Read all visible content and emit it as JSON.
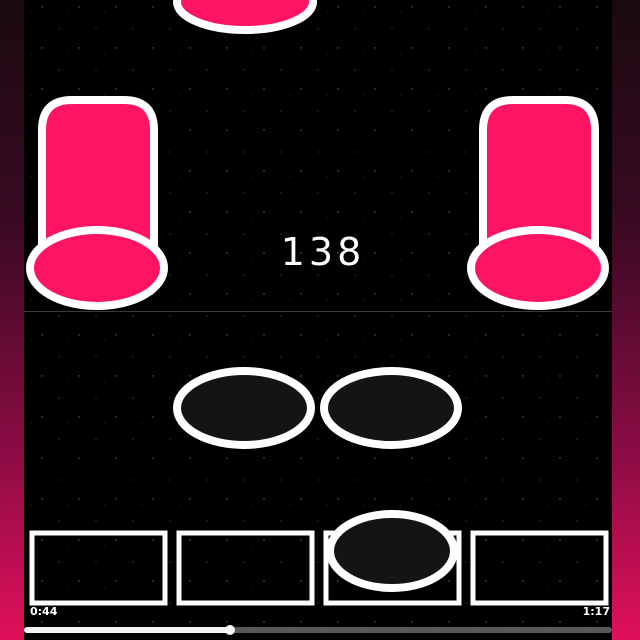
{
  "game": {
    "score": "138",
    "colors": {
      "accent": "#ff1464",
      "outline": "#ffffff",
      "background": "#000000",
      "note_fill": "#141414"
    }
  },
  "player": {
    "current_time": "0:44",
    "total_time": "1:17",
    "progress": 0.35
  }
}
